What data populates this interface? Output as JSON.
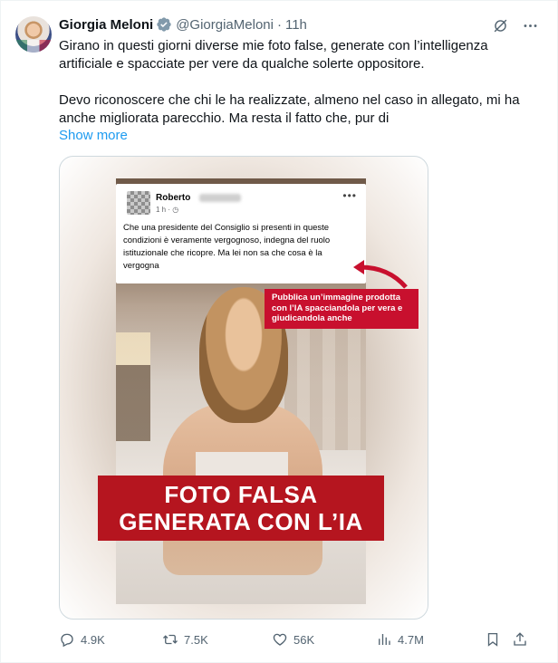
{
  "author": {
    "name": "Giorgia Meloni",
    "handle": "@GiorgiaMeloni",
    "separator": "·",
    "time": "11h"
  },
  "tweet": {
    "paragraph1": "Girano in questi giorni diverse mie foto false, generate con l’intelligenza artificiale e spacciate per vere da qualche solerte oppositore.",
    "paragraph2": "Devo riconoscere che chi le ha realizzate, almeno nel caso in allegato, mi ha anche migliorata parecchio. Ma resta il fatto che, pur di",
    "show_more": "Show more"
  },
  "media": {
    "fb_post": {
      "author": "Roberto",
      "meta": "1 h · ◷",
      "more": "•••",
      "text": "Che una presidente del Consiglio  si presenti in queste condizioni è veramente vergognoso, indegna del ruolo istituzionale che ricopre. Ma lei non sa che cosa è la vergogna"
    },
    "callout": "Pubblica un’immagine prodotta con l’IA spacciandola per vera e giudicandola anche",
    "banner_line1": "FOTO FALSA",
    "banner_line2": "GENERATA CON L’IA"
  },
  "actions": {
    "replies": "4.9K",
    "reposts": "7.5K",
    "likes": "56K",
    "views": "4.7M"
  },
  "colors": {
    "link": "#1d9bf0",
    "secondary_text": "#536471",
    "verified": "#829aab",
    "banner_red": "#b5151f"
  },
  "icons": [
    "verified-badge-icon",
    "grok-icon",
    "more-icon",
    "reply-icon",
    "repost-icon",
    "like-icon",
    "views-icon",
    "bookmark-icon",
    "share-icon"
  ]
}
